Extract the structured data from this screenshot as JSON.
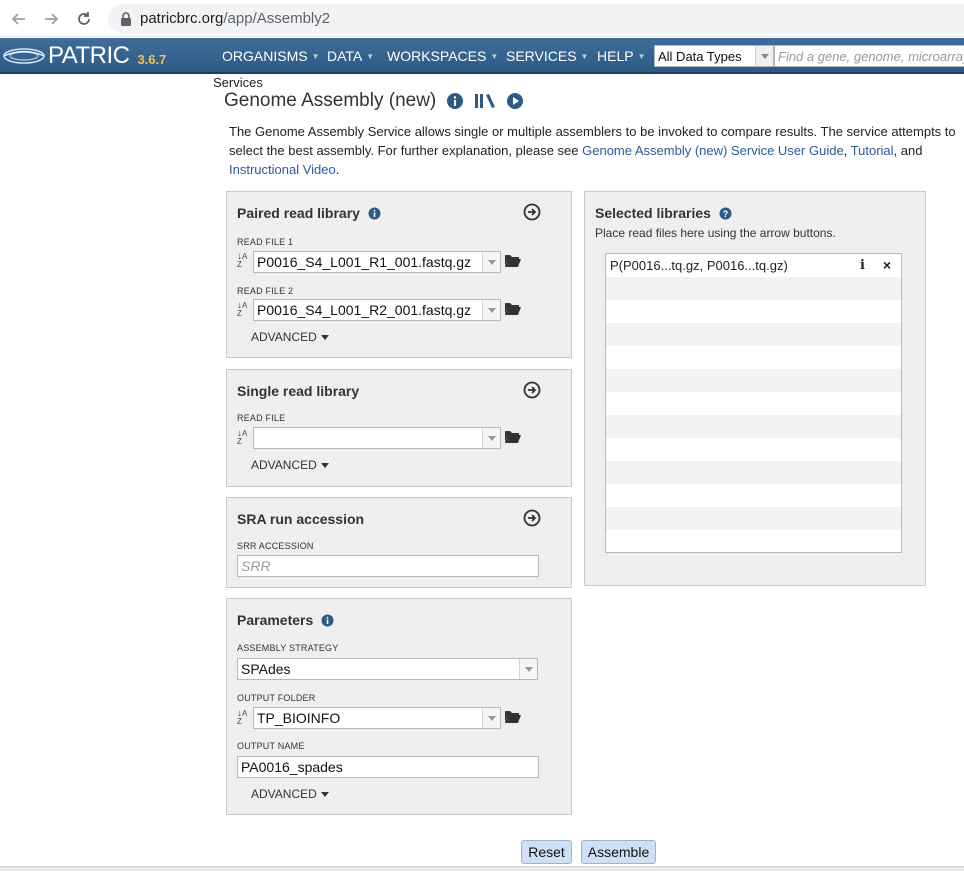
{
  "browser": {
    "url_host": "patricbrc.org",
    "url_path": "/app/Assembly2"
  },
  "header": {
    "logo_text": "PATRIC",
    "version": "3.6.7",
    "menu": [
      "ORGANISMS",
      "DATA",
      "WORKSPACES",
      "SERVICES",
      "HELP"
    ],
    "data_type_select": "All Data Types",
    "search_placeholder": "Find a gene, genome, microarray"
  },
  "breadcrumb": "Services",
  "page_title": "Genome Assembly (new)",
  "description": {
    "text": "The Genome Assembly Service allows single or multiple assemblers to be invoked to compare results. The service attempts to select the best assembly. For further explanation, please see ",
    "link_guide": "Genome Assembly (new) Service User Guide",
    "sep1": ", ",
    "link_tutorial": "Tutorial",
    "sep2": ", and ",
    "link_video": "Instructional Video",
    "end": "."
  },
  "paired": {
    "title": "Paired read library",
    "read1_label": "READ FILE 1",
    "read1_value": "P0016_S4_L001_R1_001.fastq.gz",
    "read2_label": "READ FILE 2",
    "read2_value": "P0016_S4_L001_R2_001.fastq.gz",
    "advanced": "ADVANCED"
  },
  "single": {
    "title": "Single read library",
    "read_label": "READ FILE",
    "read_value": "",
    "advanced": "ADVANCED"
  },
  "sra": {
    "title": "SRA run accession",
    "label": "SRR ACCESSION",
    "placeholder": "SRR"
  },
  "params": {
    "title": "Parameters",
    "strategy_label": "ASSEMBLY STRATEGY",
    "strategy_value": "SPAdes",
    "folder_label": "OUTPUT FOLDER",
    "folder_value": "TP_BIOINFO",
    "name_label": "OUTPUT NAME",
    "name_value": "PA0016_spades",
    "advanced": "ADVANCED"
  },
  "selected": {
    "title": "Selected libraries",
    "hint": "Place read files here using the arrow buttons.",
    "items": [
      "P(P0016...tq.gz, P0016...tq.gz)"
    ]
  },
  "buttons": {
    "reset": "Reset",
    "assemble": "Assemble"
  },
  "colors": {
    "header_bg": "#2d5a87",
    "version": "#f5c24a",
    "link": "#2a5a9a",
    "panel_bg": "#efefef",
    "button_bg": "#cfe0f5"
  }
}
